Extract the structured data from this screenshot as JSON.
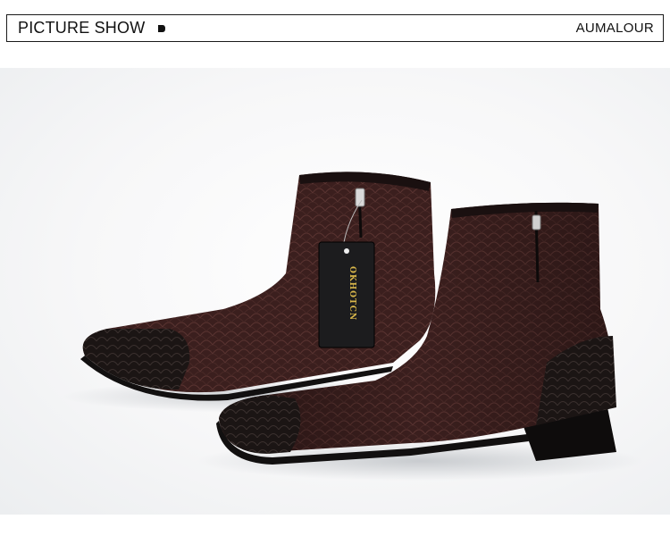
{
  "header": {
    "title": "PICTURE SHOW",
    "brand": "AUMALOUR",
    "dot_icon": "bullet-icon"
  },
  "photo": {
    "subject": "pair-of-ankle-boots",
    "tag_text": "OKHOTCN",
    "colors": {
      "leather": "#3a1d1c",
      "toe": "#1a1413",
      "tag": "#1c1c1e",
      "tag_text": "#d8b64a"
    }
  }
}
